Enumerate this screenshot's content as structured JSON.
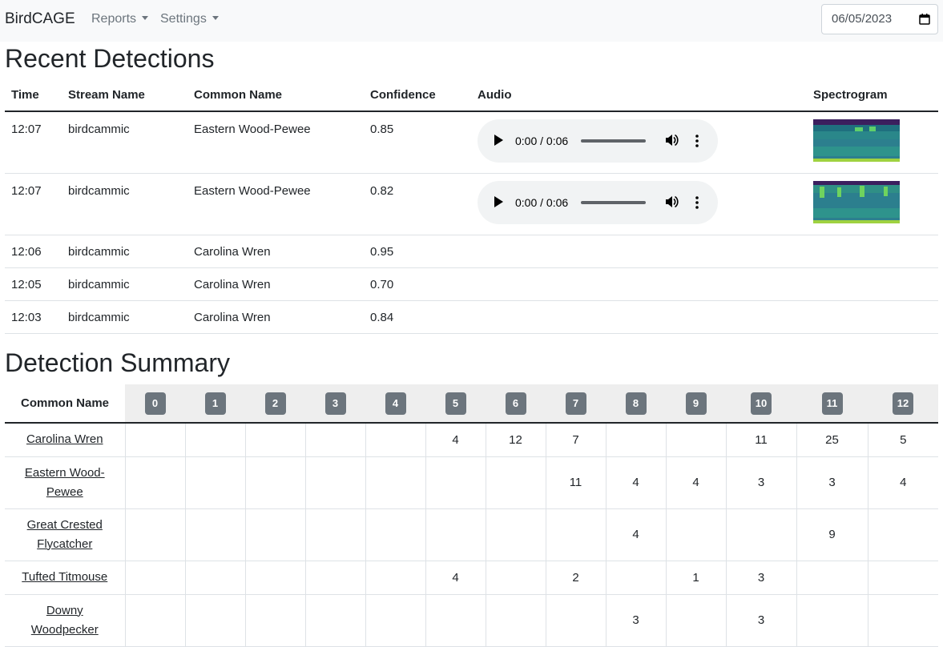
{
  "navbar": {
    "brand": "BirdCAGE",
    "reports": "Reports",
    "settings": "Settings",
    "date": "06/05/2023"
  },
  "recent": {
    "title": "Recent Detections",
    "headers": [
      "Time",
      "Stream Name",
      "Common Name",
      "Confidence",
      "Audio",
      "Spectrogram"
    ],
    "rows": [
      {
        "time": "12:07",
        "stream": "birdcammic",
        "name": "Eastern Wood-Pewee",
        "conf": "0.85",
        "audio": "0:00 / 0:06"
      },
      {
        "time": "12:07",
        "stream": "birdcammic",
        "name": "Eastern Wood-Pewee",
        "conf": "0.82",
        "audio": "0:00 / 0:06"
      },
      {
        "time": "12:06",
        "stream": "birdcammic",
        "name": "Carolina Wren",
        "conf": "0.95"
      },
      {
        "time": "12:05",
        "stream": "birdcammic",
        "name": "Carolina Wren",
        "conf": "0.70"
      },
      {
        "time": "12:03",
        "stream": "birdcammic",
        "name": "Carolina Wren",
        "conf": "0.84"
      }
    ]
  },
  "summary": {
    "title": "Detection Summary",
    "name_header": "Common Name",
    "hours": [
      "0",
      "1",
      "2",
      "3",
      "4",
      "5",
      "6",
      "7",
      "8",
      "9",
      "10",
      "11",
      "12"
    ],
    "rows": [
      {
        "name": "Carolina Wren",
        "counts": [
          "",
          "",
          "",
          "",
          "",
          "4",
          "12",
          "7",
          "",
          "",
          "11",
          "25",
          "5"
        ]
      },
      {
        "name": "Eastern Wood-Pewee",
        "counts": [
          "",
          "",
          "",
          "",
          "",
          "",
          "",
          "11",
          "4",
          "4",
          "3",
          "3",
          "4"
        ]
      },
      {
        "name": "Great Crested Flycatcher",
        "counts": [
          "",
          "",
          "",
          "",
          "",
          "",
          "",
          "",
          "4",
          "",
          "",
          "9",
          ""
        ]
      },
      {
        "name": "Tufted Titmouse",
        "counts": [
          "",
          "",
          "",
          "",
          "",
          "4",
          "",
          "2",
          "",
          "1",
          "3",
          "",
          ""
        ]
      },
      {
        "name": "Downy Woodpecker",
        "counts": [
          "",
          "",
          "",
          "",
          "",
          "",
          "",
          "",
          "3",
          "",
          "3",
          "",
          ""
        ]
      }
    ]
  }
}
